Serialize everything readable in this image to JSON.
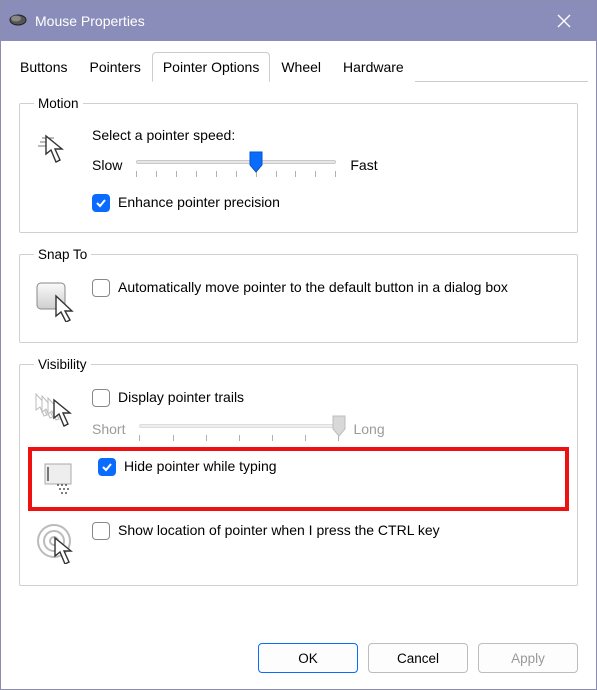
{
  "window": {
    "title": "Mouse Properties"
  },
  "tabs": {
    "items": [
      "Buttons",
      "Pointers",
      "Pointer Options",
      "Wheel",
      "Hardware"
    ],
    "active_index": 2
  },
  "motion": {
    "legend": "Motion",
    "speed_label": "Select a pointer speed:",
    "slow": "Slow",
    "fast": "Fast",
    "speed_value": 6,
    "speed_ticks": 11,
    "enhance_checked": true,
    "enhance_label": "Enhance pointer precision"
  },
  "snap": {
    "legend": "Snap To",
    "auto_checked": false,
    "auto_label": "Automatically move pointer to the default button in a dialog box"
  },
  "visibility": {
    "legend": "Visibility",
    "trails_checked": false,
    "trails_label": "Display pointer trails",
    "trails_short": "Short",
    "trails_long": "Long",
    "trails_value": 6,
    "trails_ticks": 7,
    "trails_enabled": false,
    "hide_checked": true,
    "hide_label": "Hide pointer while typing",
    "ctrl_checked": false,
    "ctrl_label": "Show location of pointer when I press the CTRL key"
  },
  "buttons": {
    "ok": "OK",
    "cancel": "Cancel",
    "apply": "Apply"
  }
}
